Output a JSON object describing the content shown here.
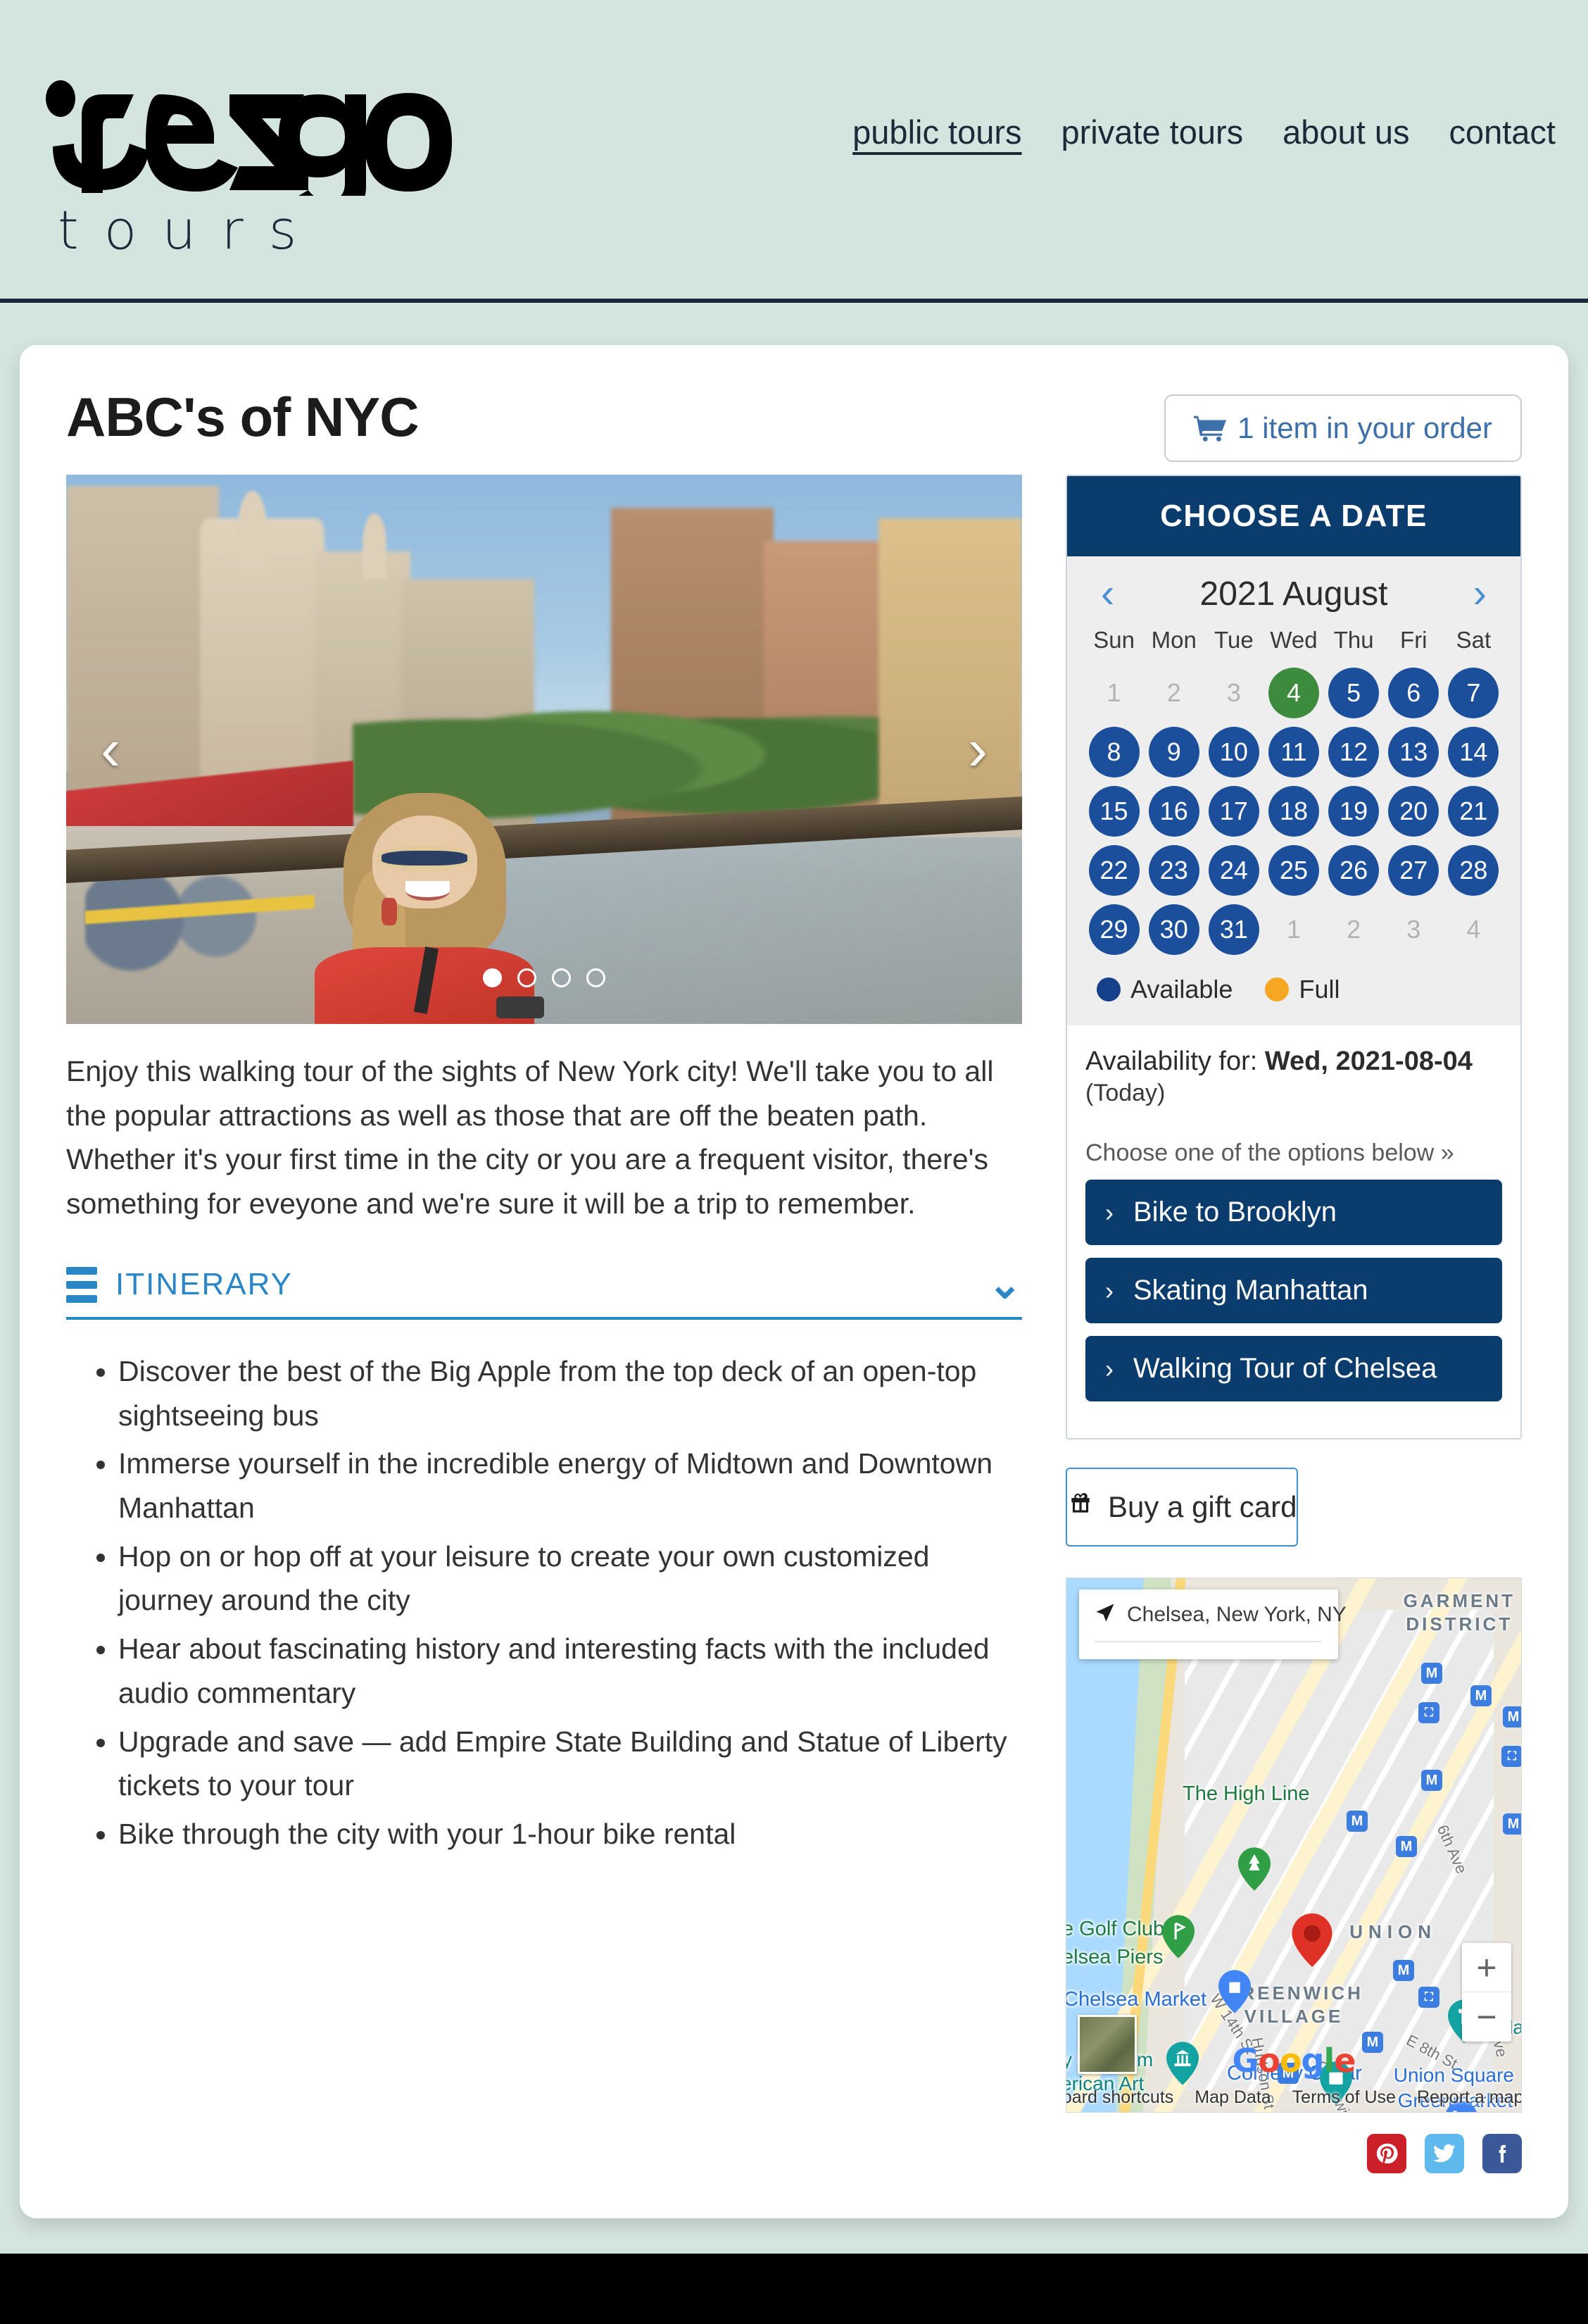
{
  "header": {
    "logo_text": "rezgo",
    "logo_subtext": "tours",
    "nav": [
      {
        "label": "public tours",
        "active": true
      },
      {
        "label": "private tours",
        "active": false
      },
      {
        "label": "about us",
        "active": false
      },
      {
        "label": "contact",
        "active": false
      }
    ]
  },
  "page": {
    "title": "ABC's of NYC",
    "cart_label": "1 item in your order"
  },
  "carousel": {
    "slide_count": 4,
    "active_index": 0,
    "prev_label": "‹",
    "next_label": "›"
  },
  "description": "Enjoy this walking tour of the sights of New York city! We'll take you to all the popular attractions as well as those that are off the beaten path. Whether it's your first time in the city or you are a frequent visitor, there's something for eveyone and we're sure it will be a trip to remember.",
  "itinerary": {
    "title": "ITINERARY",
    "expanded": true,
    "items": [
      "Discover the best of the Big Apple from the top deck of an open-top sightseeing bus",
      "Immerse yourself in the incredible energy of Midtown and Downtown Manhattan",
      "Hop on or hop off at your leisure to create your own customized journey around the city",
      "Hear about fascinating history and interesting facts with the included audio commentary",
      "Upgrade and save — add Empire State Building and Statue of Liberty tickets to your tour",
      "Bike through the city with your 1-hour bike rental"
    ]
  },
  "calendar": {
    "heading": "CHOOSE A DATE",
    "month_label": "2021 August",
    "prev_arrow": "‹",
    "next_arrow": "›",
    "day_names": [
      "Sun",
      "Mon",
      "Tue",
      "Wed",
      "Thu",
      "Fri",
      "Sat"
    ],
    "cells": [
      {
        "label": "1",
        "state": "muted"
      },
      {
        "label": "2",
        "state": "muted"
      },
      {
        "label": "3",
        "state": "muted"
      },
      {
        "label": "4",
        "state": "today"
      },
      {
        "label": "5",
        "state": "available"
      },
      {
        "label": "6",
        "state": "available"
      },
      {
        "label": "7",
        "state": "available"
      },
      {
        "label": "8",
        "state": "available"
      },
      {
        "label": "9",
        "state": "available"
      },
      {
        "label": "10",
        "state": "available"
      },
      {
        "label": "11",
        "state": "available"
      },
      {
        "label": "12",
        "state": "available"
      },
      {
        "label": "13",
        "state": "available"
      },
      {
        "label": "14",
        "state": "available"
      },
      {
        "label": "15",
        "state": "available"
      },
      {
        "label": "16",
        "state": "available"
      },
      {
        "label": "17",
        "state": "available"
      },
      {
        "label": "18",
        "state": "available"
      },
      {
        "label": "19",
        "state": "available"
      },
      {
        "label": "20",
        "state": "available"
      },
      {
        "label": "21",
        "state": "available"
      },
      {
        "label": "22",
        "state": "available"
      },
      {
        "label": "23",
        "state": "available"
      },
      {
        "label": "24",
        "state": "available"
      },
      {
        "label": "25",
        "state": "available"
      },
      {
        "label": "26",
        "state": "available"
      },
      {
        "label": "27",
        "state": "available"
      },
      {
        "label": "28",
        "state": "available"
      },
      {
        "label": "29",
        "state": "available"
      },
      {
        "label": "30",
        "state": "available"
      },
      {
        "label": "31",
        "state": "available"
      },
      {
        "label": "1",
        "state": "muted"
      },
      {
        "label": "2",
        "state": "muted"
      },
      {
        "label": "3",
        "state": "muted"
      },
      {
        "label": "4",
        "state": "muted"
      }
    ],
    "legend": [
      {
        "label": "Available",
        "color": "#17408b"
      },
      {
        "label": "Full",
        "color": "#f5a623"
      }
    ]
  },
  "availability": {
    "prefix": "Availability for:",
    "date": "Wed, 2021-08-04",
    "today_note": "(Today)",
    "choose_label": "Choose one of the options below »",
    "options": [
      "Bike to Brooklyn",
      "Skating Manhattan",
      "Walking Tour of Chelsea"
    ]
  },
  "gift_card": {
    "label": "Buy a gift card"
  },
  "map": {
    "search_value": "Chelsea, New York, NY",
    "district_labels": [
      "GARMENT\nDISTRICT",
      "GREENWICH\nVILLAGE",
      "UNION"
    ],
    "poi_labels": [
      "The High Line",
      "e Golf Club",
      "elsea Piers",
      "Chelsea Market",
      "y Museum",
      "erican Art",
      "Union Square",
      "Greenmarket",
      "Fla",
      "Comedy Cellar"
    ],
    "street_labels": [
      "W 14th St",
      "Hudson St",
      "Greenwich Ave",
      "6th Ave",
      "E 8th St",
      "d Ave"
    ],
    "zoom_in": "+",
    "zoom_out": "−",
    "brand": "Google",
    "footer_links": [
      "Keyboard shortcuts",
      "Map Data",
      "Terms of Use",
      "Report a map error"
    ]
  },
  "social": [
    {
      "name": "pinterest",
      "color": "#cb2027"
    },
    {
      "name": "twitter",
      "color": "#5fb9ec"
    },
    {
      "name": "facebook",
      "color": "#3b5998"
    }
  ],
  "colors": {
    "page_bg": "#d4e4de",
    "navy": "#0b3c6e",
    "accent_blue": "#2b86c5",
    "available_blue": "#1b4f9c",
    "today_green": "#3d8b3d",
    "full_orange": "#f5a623"
  }
}
